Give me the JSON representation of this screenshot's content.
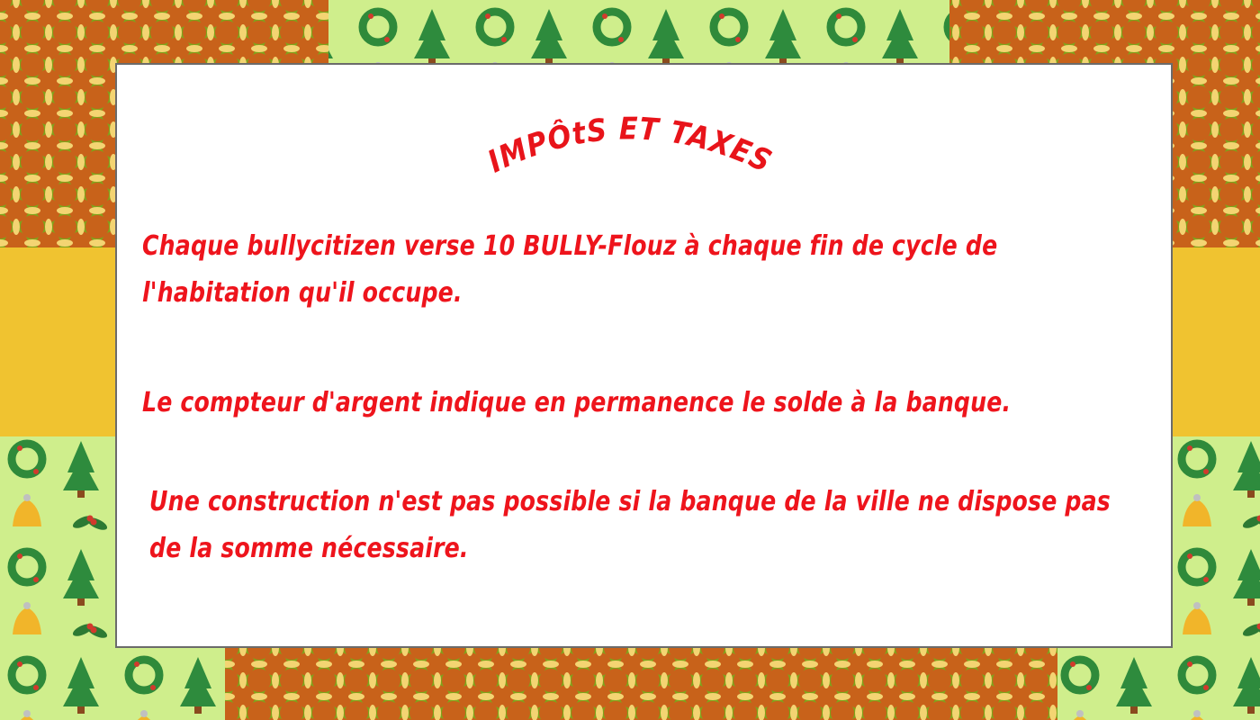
{
  "title": "IMPÔtS ET TAXES",
  "paragraphs": {
    "p1_line1": "Chaque bullycitizen verse 10 BULLY-Flouz à chaque fin de cycle de",
    "p1_line2": "l'habitation qu'il occupe.",
    "p2_line1": "Le compteur d'argent indique en permanence le solde à la banque.",
    "p3_line1": "Une construction n'est pas possible si la banque de la ville ne dispose pas",
    "p3_line2": "de la somme nécessaire."
  },
  "colors": {
    "text": "#ee141c",
    "panel": "#ffffff",
    "pattern_dark": "#c8621a",
    "pattern_green": "#7fa31b",
    "pattern_light": "#f4d472",
    "christmas_bg": "#cfee8c",
    "yellow_band": "#f0c330"
  },
  "icons": [
    "christmas-tree-icon",
    "wreath-icon",
    "bell-icon",
    "holly-icon"
  ]
}
